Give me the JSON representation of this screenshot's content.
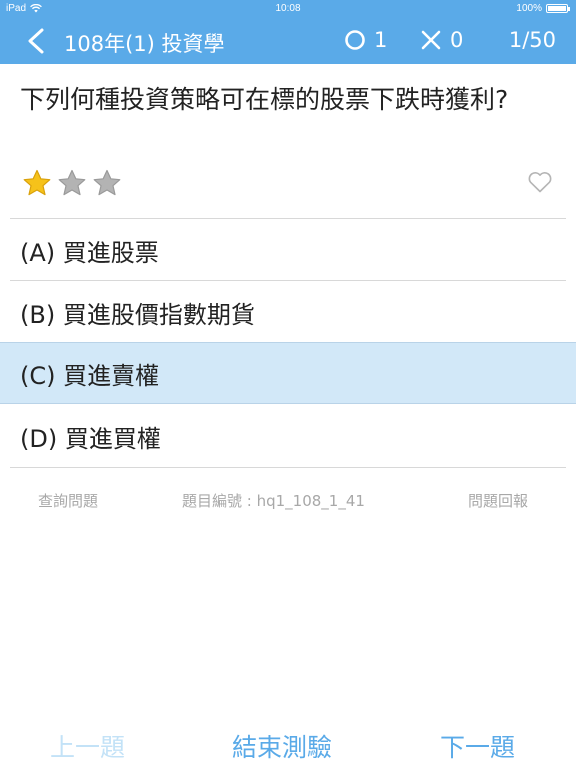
{
  "status_bar": {
    "device": "iPad",
    "time": "10:08",
    "battery": "100%",
    "battery_level": 1.0
  },
  "nav": {
    "title": "108年(1) 投資學",
    "correct_count": "1",
    "wrong_count": "0",
    "progress": "1/50"
  },
  "question": {
    "text": "下列何種投資策略可在標的股票下跌時獲利?",
    "difficulty_stars": 1,
    "difficulty_max": 3
  },
  "options": [
    {
      "label": "(A) 買進股票",
      "selected": false
    },
    {
      "label": "(B) 買進股價指數期貨",
      "selected": false
    },
    {
      "label": "(C) 買進賣權",
      "selected": true
    },
    {
      "label": "(D) 買進買權",
      "selected": false
    }
  ],
  "links": {
    "query": "查詢問題",
    "question_id": "題目編號 : hq1_108_1_41",
    "report": "問題回報"
  },
  "bottom": {
    "prev": "上一題",
    "end": "結束測驗",
    "next": "下一題"
  },
  "colors": {
    "accent": "#5aaae8",
    "selected_bg": "#d2e8f8",
    "disabled": "#c3e2f7",
    "active_text": "#5aaae8",
    "star_gold": "#f6c21a",
    "star_gray": "#b3b3b3"
  }
}
